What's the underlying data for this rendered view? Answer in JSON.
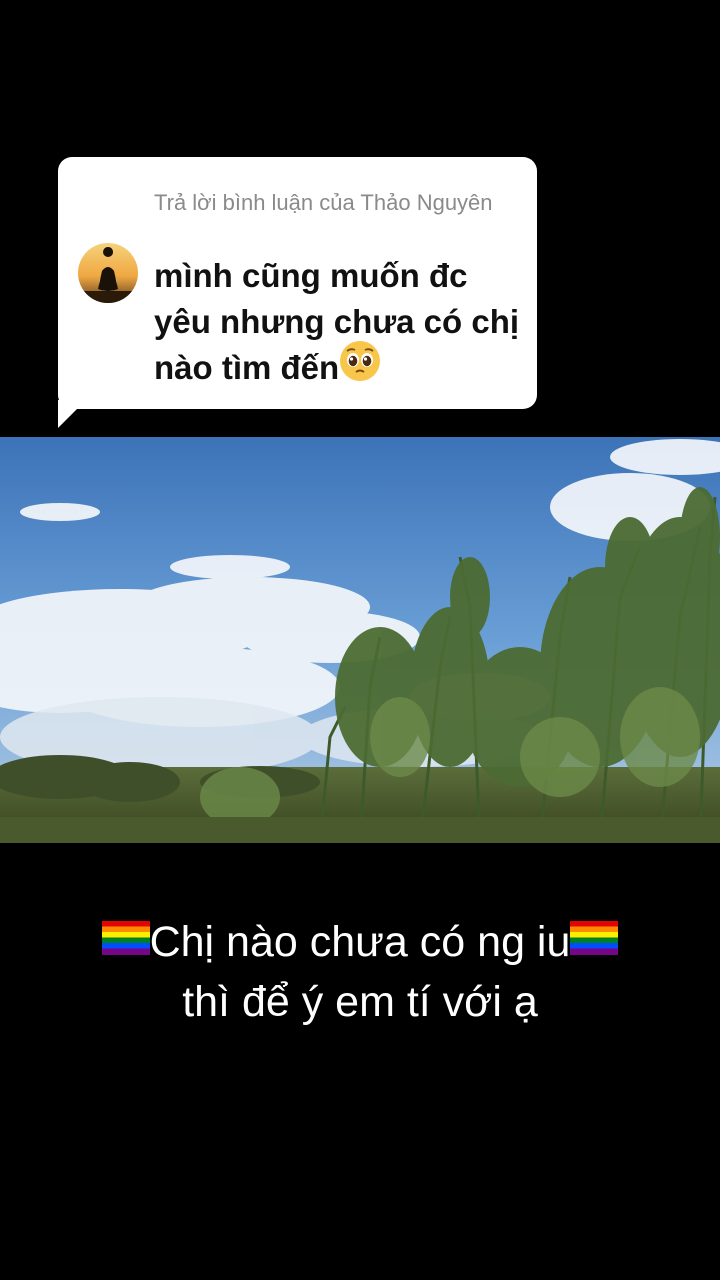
{
  "reply": {
    "header": "Trả lời bình luận của Thảo Nguyên",
    "comment_text": "mình cũng muốn đc yêu nhưng chưa có chị nào tìm đến",
    "emoji": "pleading-face-icon"
  },
  "caption": {
    "line1": "Chị nào chưa có ng iu",
    "line2": "thì để ý em tí với ạ",
    "flag_icon": "rainbow-flag-icon"
  },
  "colors": {
    "background": "#000000",
    "card": "#ffffff",
    "header_text": "#8a8a8a",
    "comment_text": "#111111",
    "caption_text": "#ffffff"
  }
}
